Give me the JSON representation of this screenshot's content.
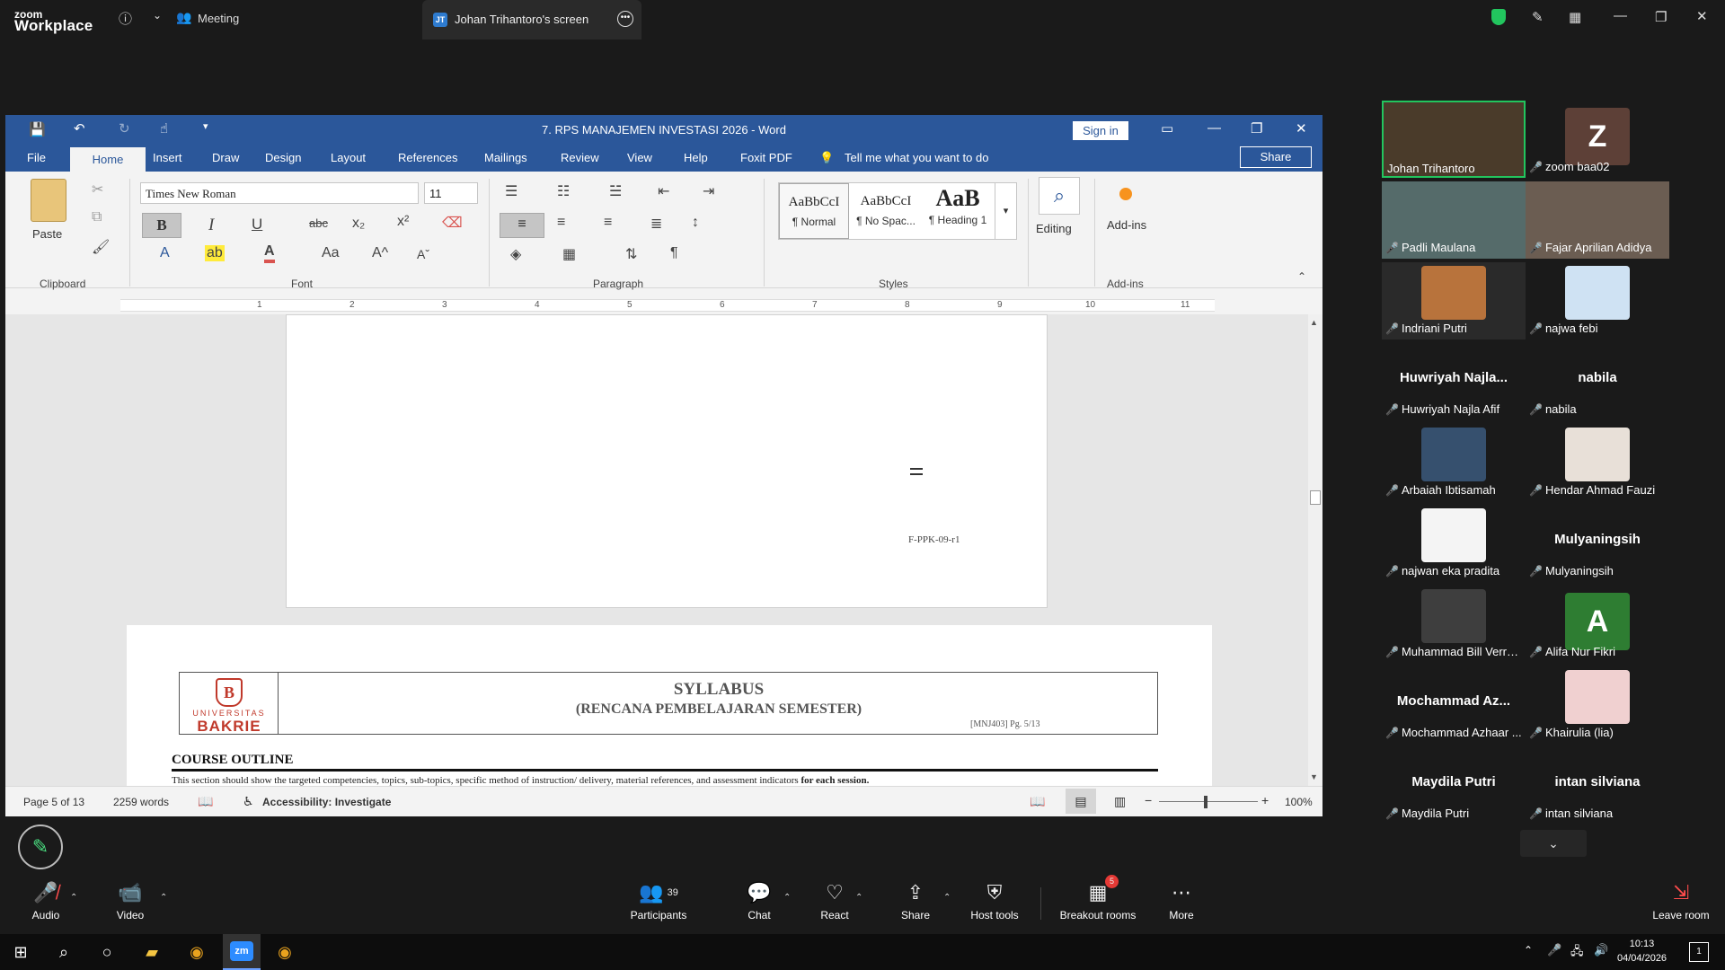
{
  "zoom": {
    "logo_small": "zoom",
    "logo_big": "Workplace",
    "meeting_tab": "Meeting",
    "screen_tab_badge": "JT",
    "screen_tab_label": "Johan Trihantoro's screen"
  },
  "word": {
    "title": "7. RPS MANAJEMEN INVESTASI 2026  -  Word",
    "sign_in": "Sign in",
    "tabs": [
      "File",
      "Home",
      "Insert",
      "Draw",
      "Design",
      "Layout",
      "References",
      "Mailings",
      "Review",
      "View",
      "Help",
      "Foxit PDF"
    ],
    "tell_me": "Tell me what you want to do",
    "share": "Share",
    "ribbon": {
      "paste": "Paste",
      "font_name": "Times New Roman",
      "font_size": "11",
      "group_clipboard": "Clipboard",
      "group_font": "Font",
      "group_paragraph": "Paragraph",
      "group_styles": "Styles",
      "group_addins": "Add-ins",
      "editing": "Editing",
      "addins": "Add-ins",
      "styles": [
        {
          "sample": "AaBbCcI",
          "name": "¶ Normal"
        },
        {
          "sample": "AaBbCcI",
          "name": "¶ No Spac..."
        },
        {
          "sample": "AaB",
          "name": "¶ Heading 1"
        }
      ]
    },
    "ruler_numbers": [
      "1",
      "2",
      "3",
      "4",
      "5",
      "6",
      "7",
      "8",
      "9",
      "10",
      "11"
    ],
    "document": {
      "page1_code": "F-PPK-09-r1",
      "logo_univ": "UNIVERSITAS",
      "logo_bakrie": "BAKRIE",
      "syllabus_title": "SYLLABUS",
      "syllabus_sub": "(RENCANA PEMBELAJARAN SEMESTER)",
      "syllabus_code": "[MNJ403]   Pg. 5/13",
      "course_outline": "COURSE OUTLINE",
      "outline_text": "This section should show the targeted competencies, topics, sub-topics, specific method of instruction/ delivery, material references, and assessment indicators ",
      "outline_text_bold": "for each session."
    },
    "status": {
      "page": "Page 5 of 13",
      "words": "2259 words",
      "accessibility": "Accessibility: Investigate",
      "zoom": "100%"
    }
  },
  "gallery": [
    {
      "name": "Johan Trihantoro",
      "big": "",
      "avatar": "",
      "active": true
    },
    {
      "name": "zoom baa02",
      "big": "",
      "avatar": "Z"
    },
    {
      "name": "Padli Maulana",
      "big": "",
      "avatar": ""
    },
    {
      "name": "Fajar Aprilian Adidya",
      "big": "",
      "avatar": ""
    },
    {
      "name": "Indriani Putri",
      "big": "",
      "avatar": ""
    },
    {
      "name": "najwa febi",
      "big": "",
      "avatar": ""
    },
    {
      "name": "Huwriyah Najla Afif",
      "big": "Huwriyah  Najla...",
      "avatar": ""
    },
    {
      "name": "nabila",
      "big": "nabila",
      "avatar": ""
    },
    {
      "name": "Arbaiah Ibtisamah",
      "big": "",
      "avatar": ""
    },
    {
      "name": "Hendar Ahmad Fauzi",
      "big": "",
      "avatar": ""
    },
    {
      "name": "najwan eka pradita",
      "big": "",
      "avatar": ""
    },
    {
      "name": "Mulyaningsih",
      "big": "Mulyaningsih",
      "avatar": ""
    },
    {
      "name": "Muhammad Bill Verre...",
      "big": "",
      "avatar": ""
    },
    {
      "name": "Alifa Nur Fikri",
      "big": "",
      "avatar": "A"
    },
    {
      "name": "Mochammad Azhaar ...",
      "big": "Mochammad  Az...",
      "avatar": ""
    },
    {
      "name": "Khairulia (lia)",
      "big": "",
      "avatar": ""
    },
    {
      "name": "Maydila Putri",
      "big": "Maydila Putri",
      "avatar": ""
    },
    {
      "name": "intan silviana",
      "big": "intan silviana",
      "avatar": ""
    }
  ],
  "controls": {
    "audio": "Audio",
    "video": "Video",
    "participants": "Participants",
    "participants_count": "39",
    "chat": "Chat",
    "react": "React",
    "share": "Share",
    "host_tools": "Host tools",
    "breakout_rooms": "Breakout rooms",
    "breakout_badge": "5",
    "more": "More",
    "leave": "Leave room"
  },
  "taskbar": {
    "time": "10:13",
    "date": "04/04/2026",
    "notif_count": "1"
  },
  "colors": {
    "word_blue": "#2b579a",
    "zoom_bg": "#1a1a1a",
    "active_speaker": "#22c55e",
    "mute_red": "#ff4c4c"
  }
}
